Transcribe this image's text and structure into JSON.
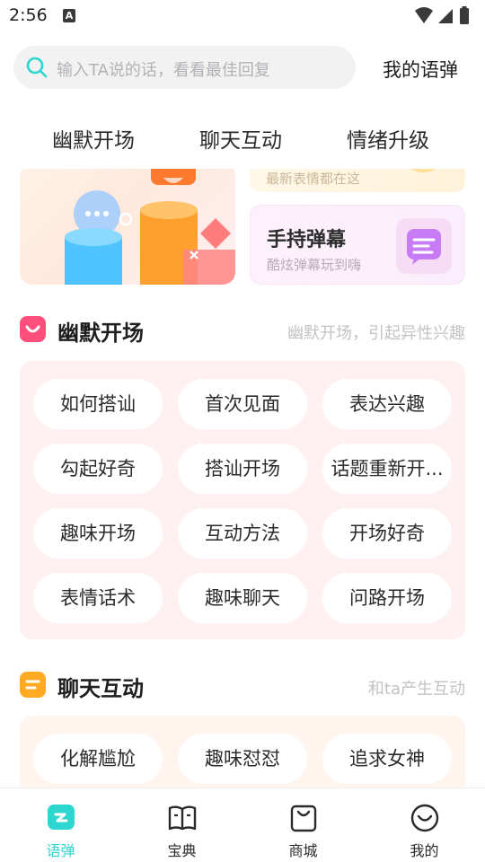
{
  "status_bar": {
    "time": "2:56",
    "notification_glyph": "A"
  },
  "search": {
    "placeholder": "输入TA说的话，看看最佳回复",
    "icon": "search-icon"
  },
  "header": {
    "my_danmu_label": "我的语弹"
  },
  "tabs": [
    {
      "label": "幽默开场"
    },
    {
      "label": "聊天互动"
    },
    {
      "label": "情绪升级"
    }
  ],
  "banners": {
    "top_right_subtitle": "最新表情都在这",
    "bottom_right": {
      "title": "手持弹幕",
      "subtitle": "酷炫弹幕玩到嗨"
    }
  },
  "sections": [
    {
      "title": "幽默开场",
      "subtitle": "幽默开场，引起异性兴趣",
      "accent": "#ff4f7a",
      "tags": [
        "如何搭讪",
        "首次见面",
        "表达兴趣",
        "勾起好奇",
        "搭讪开场",
        "话题重新开...",
        "趣味开场",
        "互动方法",
        "开场好奇",
        "表情话术",
        "趣味聊天",
        "问路开场"
      ]
    },
    {
      "title": "聊天互动",
      "subtitle": "和ta产生互动",
      "accent": "#ffaa22",
      "tags": [
        "化解尴尬",
        "趣味怼怼",
        "追求女神"
      ]
    }
  ],
  "bottom_nav": [
    {
      "label": "语弹",
      "icon": "chat-bubble-icon",
      "active": true
    },
    {
      "label": "宝典",
      "icon": "book-icon",
      "active": false
    },
    {
      "label": "商城",
      "icon": "shopping-bag-icon",
      "active": false
    },
    {
      "label": "我的",
      "icon": "smiley-face-icon",
      "active": false
    }
  ],
  "colors": {
    "accent": "#2ed6d0",
    "section1_panel": "#fff0f1",
    "section2_panel": "#fff4ee"
  }
}
